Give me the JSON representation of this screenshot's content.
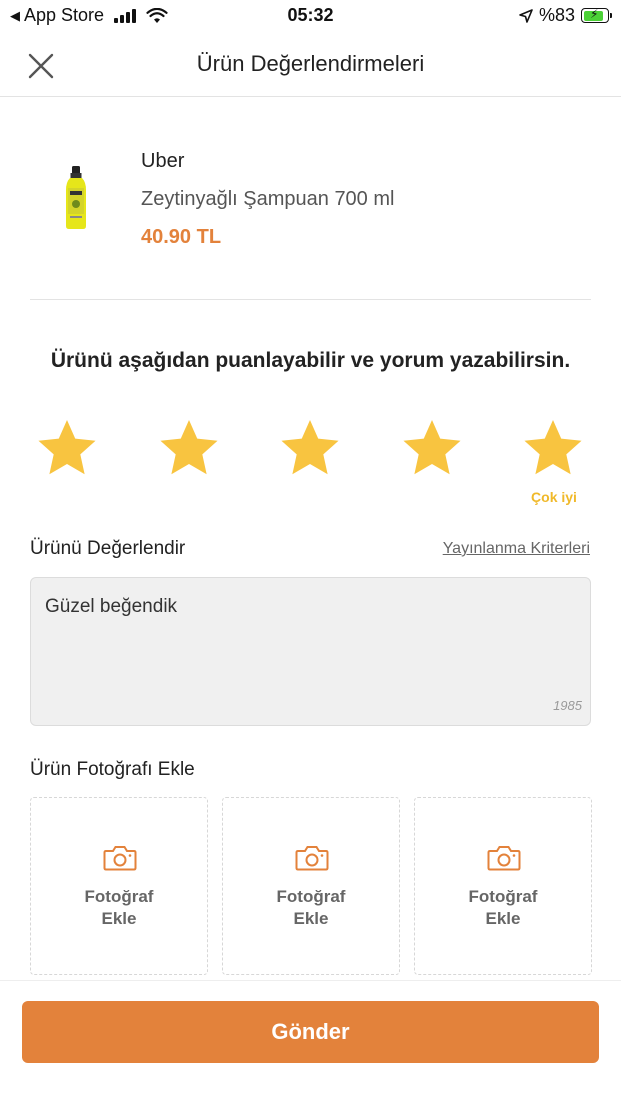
{
  "status_bar": {
    "back_app": "App Store",
    "time": "05:32",
    "battery": "%83",
    "battery_level": 0.83
  },
  "header": {
    "title": "Ürün Değerlendirmeleri",
    "close_icon": "close-icon"
  },
  "product": {
    "brand": "Uber",
    "name": "Zeytinyağlı Şampuan 700 ml",
    "price": "40.90 TL"
  },
  "rating": {
    "prompt": "Ürünü aşağıdan puanlayabilir ve yorum yazabilirsin.",
    "value": 5,
    "max": 5,
    "caption": "Çok iyi",
    "star_color": "#f8c440"
  },
  "review": {
    "section_title": "Ürünü Değerlendir",
    "criteria_link": "Yayınlanma Kriterleri",
    "text": "Güzel beğendik",
    "char_count": "1985"
  },
  "photos": {
    "section_title": "Ürün Fotoğrafı Ekle",
    "slots": [
      {
        "line1": "Fotoğraf",
        "line2": "Ekle"
      },
      {
        "line1": "Fotoğraf",
        "line2": "Ekle"
      },
      {
        "line1": "Fotoğraf",
        "line2": "Ekle"
      }
    ],
    "icon": "camera-icon"
  },
  "submit": {
    "label": "Gönder"
  },
  "colors": {
    "accent": "#e3823b",
    "star": "#f8c440"
  }
}
